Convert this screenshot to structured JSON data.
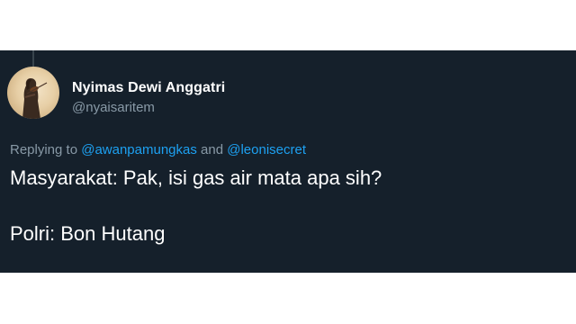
{
  "author": {
    "name": "Nyimas Dewi Anggatri",
    "handle": "@nyaisaritem"
  },
  "reply": {
    "prefix": "Replying to",
    "mention1": "@awanpamungkas",
    "conjunction": "and",
    "mention2": "@leonisecret"
  },
  "tweet": {
    "line1": "Masyarakat: Pak, isi gas air mata apa sih?",
    "line2": "Polri: Bon Hutang"
  },
  "colors": {
    "background": "#15202b",
    "secondary_text": "#8899a6",
    "link": "#1da1f2",
    "primary_text": "#ffffff"
  }
}
